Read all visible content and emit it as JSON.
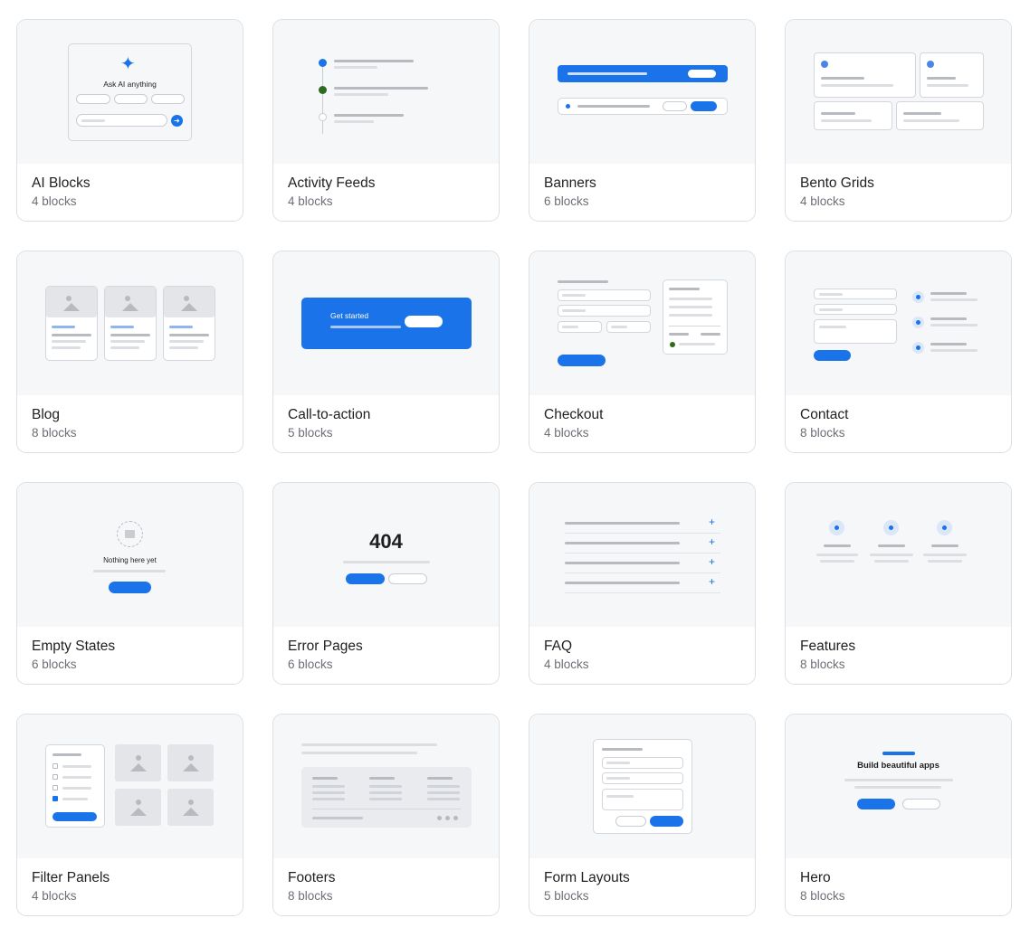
{
  "cards": [
    {
      "title": "AI Blocks",
      "count": "4 blocks",
      "preview_text": "Ask AI anything"
    },
    {
      "title": "Activity Feeds",
      "count": "4 blocks"
    },
    {
      "title": "Banners",
      "count": "6 blocks"
    },
    {
      "title": "Bento Grids",
      "count": "4 blocks"
    },
    {
      "title": "Blog",
      "count": "8 blocks"
    },
    {
      "title": "Call-to-action",
      "count": "5 blocks",
      "preview_text": "Get started"
    },
    {
      "title": "Checkout",
      "count": "4 blocks"
    },
    {
      "title": "Contact",
      "count": "8 blocks"
    },
    {
      "title": "Empty States",
      "count": "6 blocks",
      "preview_text": "Nothing here yet"
    },
    {
      "title": "Error Pages",
      "count": "6 blocks",
      "preview_text": "404"
    },
    {
      "title": "FAQ",
      "count": "4 blocks",
      "preview_icon": "+"
    },
    {
      "title": "Features",
      "count": "8 blocks"
    },
    {
      "title": "Filter Panels",
      "count": "4 blocks"
    },
    {
      "title": "Footers",
      "count": "8 blocks"
    },
    {
      "title": "Form Layouts",
      "count": "5 blocks"
    },
    {
      "title": "Hero",
      "count": "8 blocks",
      "preview_text": "Build beautiful apps"
    }
  ],
  "colors": {
    "accent": "#1a73e8",
    "success": "#2e6b1f",
    "card_border": "#dcdfe4",
    "thumb_bg": "#f6f7f9"
  }
}
